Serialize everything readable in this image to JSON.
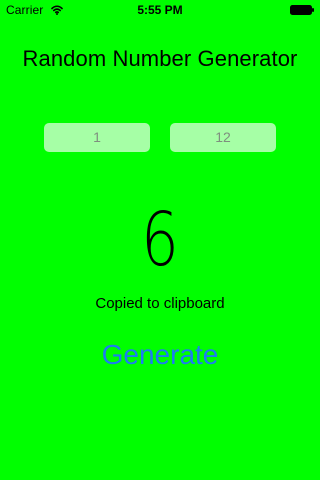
{
  "status_bar": {
    "carrier": "Carrier",
    "time": "5:55 PM",
    "wifi_icon": "wifi-icon",
    "battery_icon": "battery-icon"
  },
  "app": {
    "title": "Random Number Generator",
    "min_value": "1",
    "max_value": "12",
    "result": "6",
    "copied_text": "Copied to clipboard",
    "generate_label": "Generate"
  },
  "colors": {
    "background": "#00ff00",
    "field_background": "#a5ffa5",
    "field_text": "#7f8f7f",
    "button_text": "#1d7cf2"
  }
}
